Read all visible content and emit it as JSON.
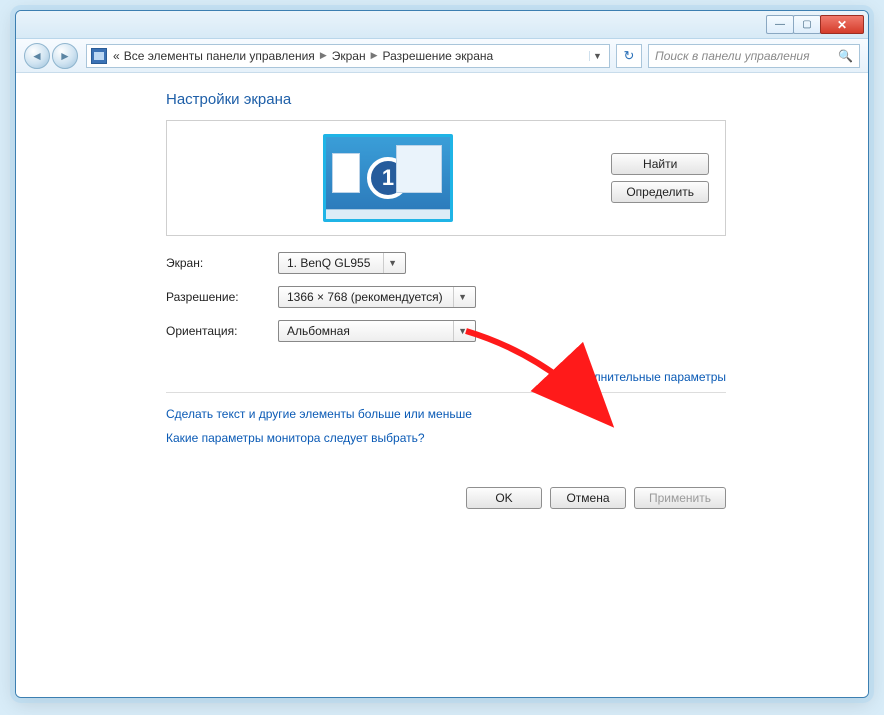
{
  "breadcrumb": {
    "prefix": "«",
    "seg1": "Все элементы панели управления",
    "seg2": "Экран",
    "seg3": "Разрешение экрана"
  },
  "search": {
    "placeholder": "Поиск в панели управления"
  },
  "heading": "Настройки экрана",
  "preview": {
    "monitor_number": "1",
    "btn_find": "Найти",
    "btn_detect": "Определить"
  },
  "form": {
    "screen_label": "Экран:",
    "screen_value": "1. BenQ GL955",
    "resolution_label": "Разрешение:",
    "resolution_value": "1366 × 768 (рекомендуется)",
    "orientation_label": "Ориентация:",
    "orientation_value": "Альбомная"
  },
  "links": {
    "advanced": "Дополнительные параметры",
    "textsize": "Сделать текст и другие элементы больше или меньше",
    "whichmon": "Какие параметры монитора следует выбрать?"
  },
  "footer": {
    "ok": "OK",
    "cancel": "Отмена",
    "apply": "Применить"
  }
}
